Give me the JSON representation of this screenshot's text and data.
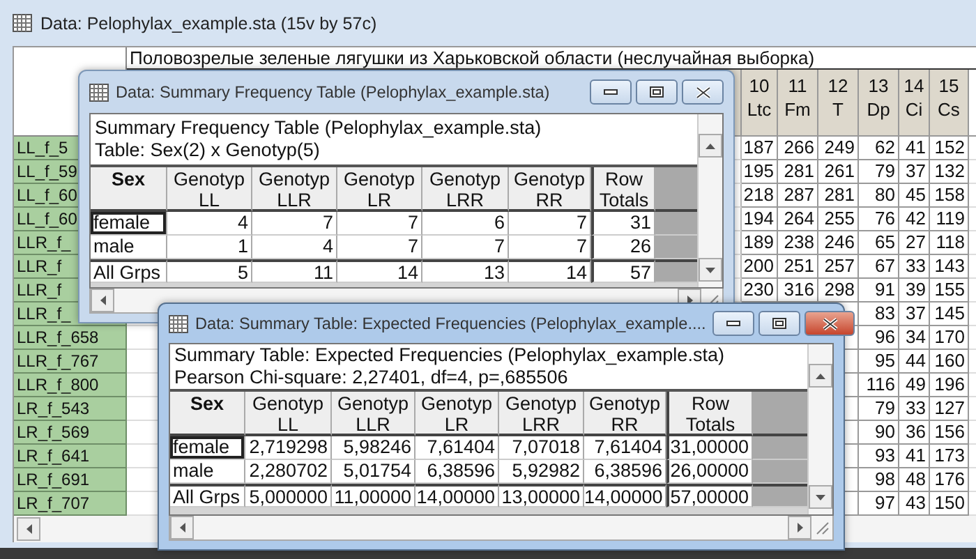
{
  "background_window": {
    "title": "Data: Pelophylax_example.sta (15v by 57c)",
    "active": false,
    "header_text": "Половозрелые зеленые лягушки из Харьковской области (неслучайная выборка)",
    "columns": [
      {
        "number": "10",
        "name": "Ltc"
      },
      {
        "number": "11",
        "name": "Fm"
      },
      {
        "number": "12",
        "name": "T"
      },
      {
        "number": "13",
        "name": "Dp"
      },
      {
        "number": "14",
        "name": "Ci"
      },
      {
        "number": "15",
        "name": "Cs"
      }
    ],
    "rows": [
      {
        "label": "LL_f_5",
        "values": [
          "187",
          "266",
          "249",
          "62",
          "41",
          "152"
        ]
      },
      {
        "label": "LL_f_59",
        "values": [
          "195",
          "281",
          "261",
          "79",
          "37",
          "132"
        ]
      },
      {
        "label": "LL_f_60",
        "values": [
          "218",
          "287",
          "281",
          "80",
          "45",
          "158"
        ]
      },
      {
        "label": "LL_f_60",
        "values": [
          "194",
          "264",
          "255",
          "76",
          "42",
          "119"
        ]
      },
      {
        "label": "LLR_f_",
        "values": [
          "189",
          "238",
          "246",
          "65",
          "27",
          "118"
        ]
      },
      {
        "label": "LLR_f",
        "values": [
          "200",
          "251",
          "257",
          "67",
          "33",
          "143"
        ]
      },
      {
        "label": "LLR_f",
        "values": [
          "230",
          "316",
          "298",
          "91",
          "39",
          "155"
        ]
      },
      {
        "label": "LLR_f_",
        "values": [
          "83",
          "37",
          "145"
        ]
      },
      {
        "label": "LLR_f_658",
        "values": [
          "96",
          "34",
          "170"
        ]
      },
      {
        "label": "LLR_f_767",
        "values": [
          "95",
          "44",
          "160"
        ]
      },
      {
        "label": "LLR_f_800",
        "values": [
          "116",
          "49",
          "196"
        ]
      },
      {
        "label": "LR_f_543",
        "values": [
          "79",
          "33",
          "127"
        ]
      },
      {
        "label": "LR_f_569",
        "values": [
          "90",
          "36",
          "156"
        ]
      },
      {
        "label": "LR_f_641",
        "values": [
          "93",
          "41",
          "173"
        ]
      },
      {
        "label": "LR_f_691",
        "values": [
          "98",
          "48",
          "176"
        ]
      },
      {
        "label": "LR_f_707",
        "values": [
          "97",
          "43",
          "150"
        ]
      }
    ]
  },
  "windows": [
    {
      "title": "Data: Summary Frequency Table (Pelophylax_example.sta)",
      "active": false,
      "lines": [
        "Summary Frequency Table (Pelophylax_example.sta)",
        "Table: Sex(2) x Genotyp(5)"
      ],
      "row_header": "Sex",
      "columns": [
        {
          "top": "Genotyp",
          "bottom": "LL"
        },
        {
          "top": "Genotyp",
          "bottom": "LLR"
        },
        {
          "top": "Genotyp",
          "bottom": "LR"
        },
        {
          "top": "Genotyp",
          "bottom": "LRR"
        },
        {
          "top": "Genotyp",
          "bottom": "RR"
        },
        {
          "top": "Row",
          "bottom": "Totals"
        }
      ],
      "rows": [
        {
          "label": "female",
          "kind": "group",
          "selected": true,
          "values": [
            "4",
            "7",
            "7",
            "6",
            "7",
            "31"
          ]
        },
        {
          "label": "male",
          "kind": "group",
          "selected": false,
          "values": [
            "1",
            "4",
            "7",
            "7",
            "7",
            "26"
          ]
        },
        {
          "label": "All Grps",
          "kind": "total",
          "selected": false,
          "values": [
            "5",
            "11",
            "14",
            "13",
            "14",
            "57"
          ]
        }
      ]
    },
    {
      "title": "Data: Summary Table: Expected Frequencies (Pelophylax_example....",
      "active": true,
      "lines": [
        "Summary Table: Expected Frequencies (Pelophylax_example.sta)",
        "Pearson Chi-square: 2,27401, df=4, p=,685506"
      ],
      "row_header": "Sex",
      "columns": [
        {
          "top": "Genotyp",
          "bottom": "LL"
        },
        {
          "top": "Genotyp",
          "bottom": "LLR"
        },
        {
          "top": "Genotyp",
          "bottom": "LR"
        },
        {
          "top": "Genotyp",
          "bottom": "LRR"
        },
        {
          "top": "Genotyp",
          "bottom": "RR"
        },
        {
          "top": "Row",
          "bottom": "Totals"
        }
      ],
      "rows": [
        {
          "label": "female",
          "kind": "group",
          "selected": true,
          "values": [
            "2,719298",
            "5,98246",
            "7,61404",
            "7,07018",
            "7,61404",
            "31,00000"
          ]
        },
        {
          "label": "male",
          "kind": "group",
          "selected": false,
          "values": [
            "2,280702",
            "5,01754",
            "6,38596",
            "5,92982",
            "6,38596",
            "26,00000"
          ]
        },
        {
          "label": "All Grps",
          "kind": "total",
          "selected": false,
          "values": [
            "5,000000",
            "11,00000",
            "14,00000",
            "13,00000",
            "14,00000",
            "57,00000"
          ]
        }
      ]
    }
  ]
}
